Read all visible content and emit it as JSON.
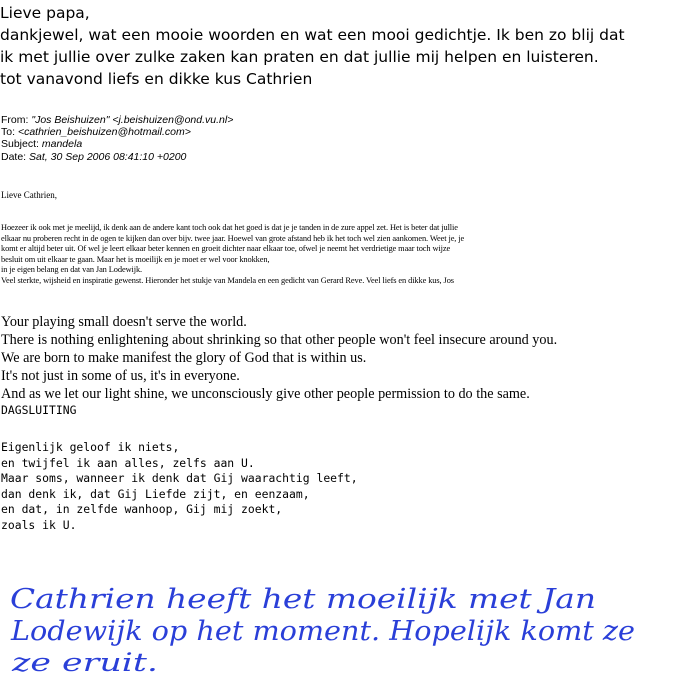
{
  "reply": {
    "lines": [
      "Lieve papa,",
      "dankjewel, wat een mooie woorden en wat een mooi gedichtje. Ik ben zo blij dat",
      "ik met jullie over zulke zaken kan praten en dat jullie mij helpen en luisteren.",
      "tot vanavond liefs en dikke kus Cathrien"
    ]
  },
  "header": {
    "from_label": "From:",
    "from_value": "\"Jos Beishuizen\" <j.beishuizen@ond.vu.nl>",
    "to_label": "To:",
    "to_value": "<cathrien_beishuizen@hotmail.com>",
    "subject_label": "Subject:",
    "subject_value": "mandela",
    "date_label": "Date:",
    "date_value": "Sat, 30 Sep 2006 08:41:10 +0200"
  },
  "body": {
    "greeting": "Lieve Cathrien,",
    "paragraph_lines": [
      "Hoezeer ik ook met je meelijd, ik denk aan de andere kant toch ook dat het goed is dat je je tanden in de zure appel zet. Het is beter dat jullie",
      "elkaar nu proberen recht in de ogen te kijken dan over bijv. twee jaar. Hoewel van grote afstand heb ik het toch wel zien aankomen. Weet je, je",
      "komt er altijd beter uit. Of wel je leert elkaar beter kennen en groeit dichter naar elkaar toe, ofwel je neemt het verdrietige maar toch wijze",
      "besluit om uit elkaar te gaan. Maar het is moeilijk en je moet er wel voor knokken,",
      "in je eigen belang en dat van Jan Lodewijk.",
      "Veel sterkte, wijsheid en inspiratie gewenst. Hieronder het stukje van Mandela en een gedicht van Gerard Reve. Veel liefs en dikke kus, Jos"
    ],
    "quote_lines": [
      "Your playing small doesn't serve the world.",
      "There is nothing enlightening about shrinking so that other people won't feel insecure around you.",
      "We are born to make manifest the glory of God that is within us.",
      "It's not just in some of us, it's in everyone.",
      "And as we let our light shine, we unconsciously give other people permission to do the same."
    ],
    "poem_title": "DAGSLUITING",
    "poem_lines": [
      "Eigenlijk geloof ik niets,",
      "en twijfel ik aan alles, zelfs aan U.",
      "Maar soms, wanneer ik denk dat Gij waarachtig leeft,",
      "dan denk ik, dat Gij Liefde zijt, en eenzaam,",
      "en dat, in zelfde wanhoop, Gij mij zoekt,",
      "zoals ik U."
    ]
  },
  "handwriting": {
    "lines": [
      "Cathrien heeft het moeilijk met Jan",
      "Lodewijk op het moment. Hopelijk komt ze",
      "ze eruit."
    ],
    "ink_color": "#2a3fd8"
  }
}
